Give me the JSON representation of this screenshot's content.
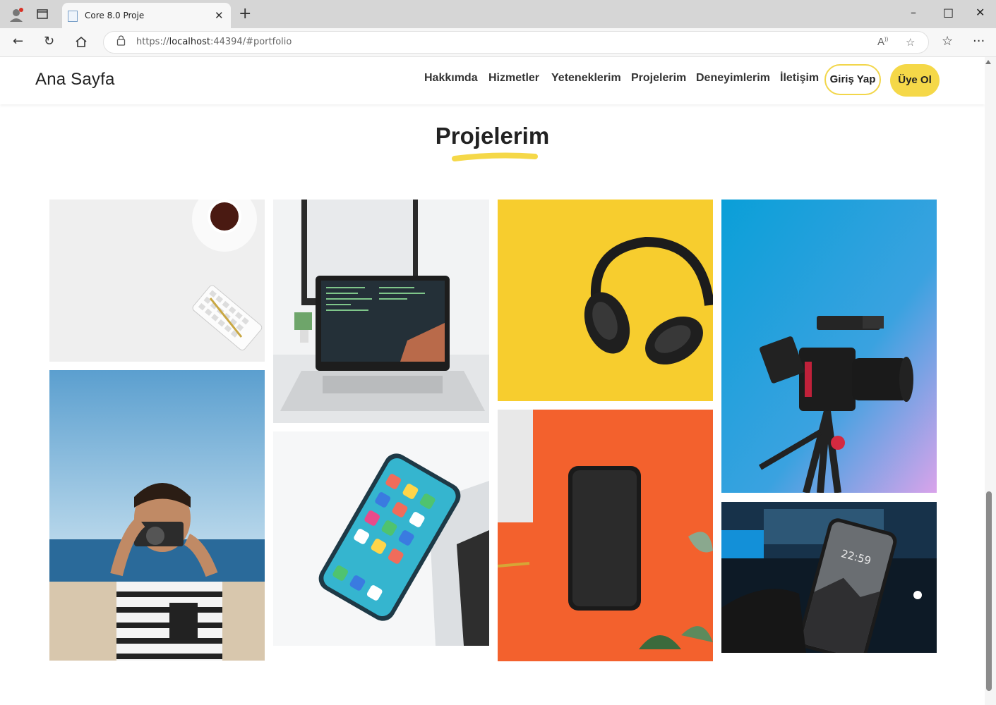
{
  "browser": {
    "tab_title": "Core 8.0 Proje",
    "url_prefix": "https://",
    "url_host": "localhost",
    "url_rest": ":44394/#portfolio",
    "icons": [
      "profile-icon",
      "tab-actions-icon",
      "close-icon",
      "new-tab-icon",
      "minimize-icon",
      "maximize-icon",
      "close-window-icon",
      "back-icon",
      "reload-icon",
      "home-icon",
      "lock-icon",
      "read-aloud-icon",
      "favorite-icon",
      "favorites-icon",
      "more-icon"
    ]
  },
  "header": {
    "brand": "Ana Sayfa",
    "nav": [
      "Hakkımda",
      "Hizmetler",
      "Yeteneklerim",
      "Projelerim",
      "Deneyimlerim",
      "İletişim"
    ],
    "login": "Giriş Yap",
    "signup": "Üye Ol"
  },
  "section": {
    "title": "Projelerim"
  },
  "colors": {
    "accent": "#f5d848",
    "text": "#222222"
  }
}
